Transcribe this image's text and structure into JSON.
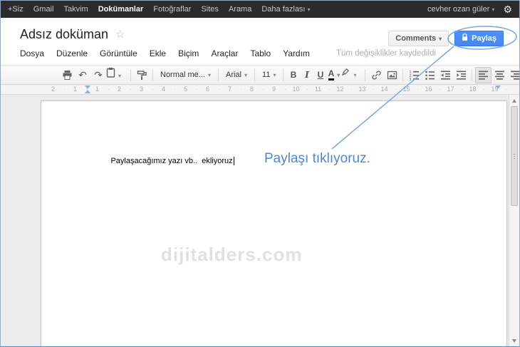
{
  "topbar": {
    "items": [
      "+Siz",
      "Gmail",
      "Takvim",
      "Dokümanlar",
      "Fotoğraflar",
      "Sites",
      "Arama"
    ],
    "more_label": "Daha fazlası",
    "user_name": "cevher ozan güler",
    "gear_icon": "⚙"
  },
  "header": {
    "doc_title": "Adsız doküman",
    "star_icon": "☆",
    "comments_button": "Comments",
    "share_button": "Paylaş"
  },
  "menubar": {
    "items": [
      "Dosya",
      "Düzenle",
      "Görüntüle",
      "Ekle",
      "Biçim",
      "Araçlar",
      "Tablo",
      "Yardım"
    ],
    "save_status": "Tüm değişiklikler kaydedildi"
  },
  "toolbar": {
    "undo_icon": "↶",
    "redo_icon": "↷",
    "style_select": "Normal me...",
    "font_select": "Arial",
    "size_select": "11",
    "bold_label": "B",
    "italic_label": "I",
    "underline_label": "U",
    "text_color_label": "A"
  },
  "ruler": {
    "numbers": [
      "2",
      "1",
      "1",
      "2",
      "3",
      "4",
      "5",
      "6",
      "7",
      "8",
      "9",
      "10",
      "11",
      "12",
      "13",
      "14",
      "15",
      "16",
      "17",
      "18",
      "19"
    ]
  },
  "document": {
    "body_text": "Paylaşacağımız yazı vb..  ekliyoruz",
    "annotation_text": "Paylaşı tıklıyoruz.",
    "watermark": "dijitalders.com"
  },
  "colors": {
    "topbar_black": "#2b2b2b",
    "share_button_blue": "#4d90fe",
    "annotation_blue": "#4d86dc"
  }
}
